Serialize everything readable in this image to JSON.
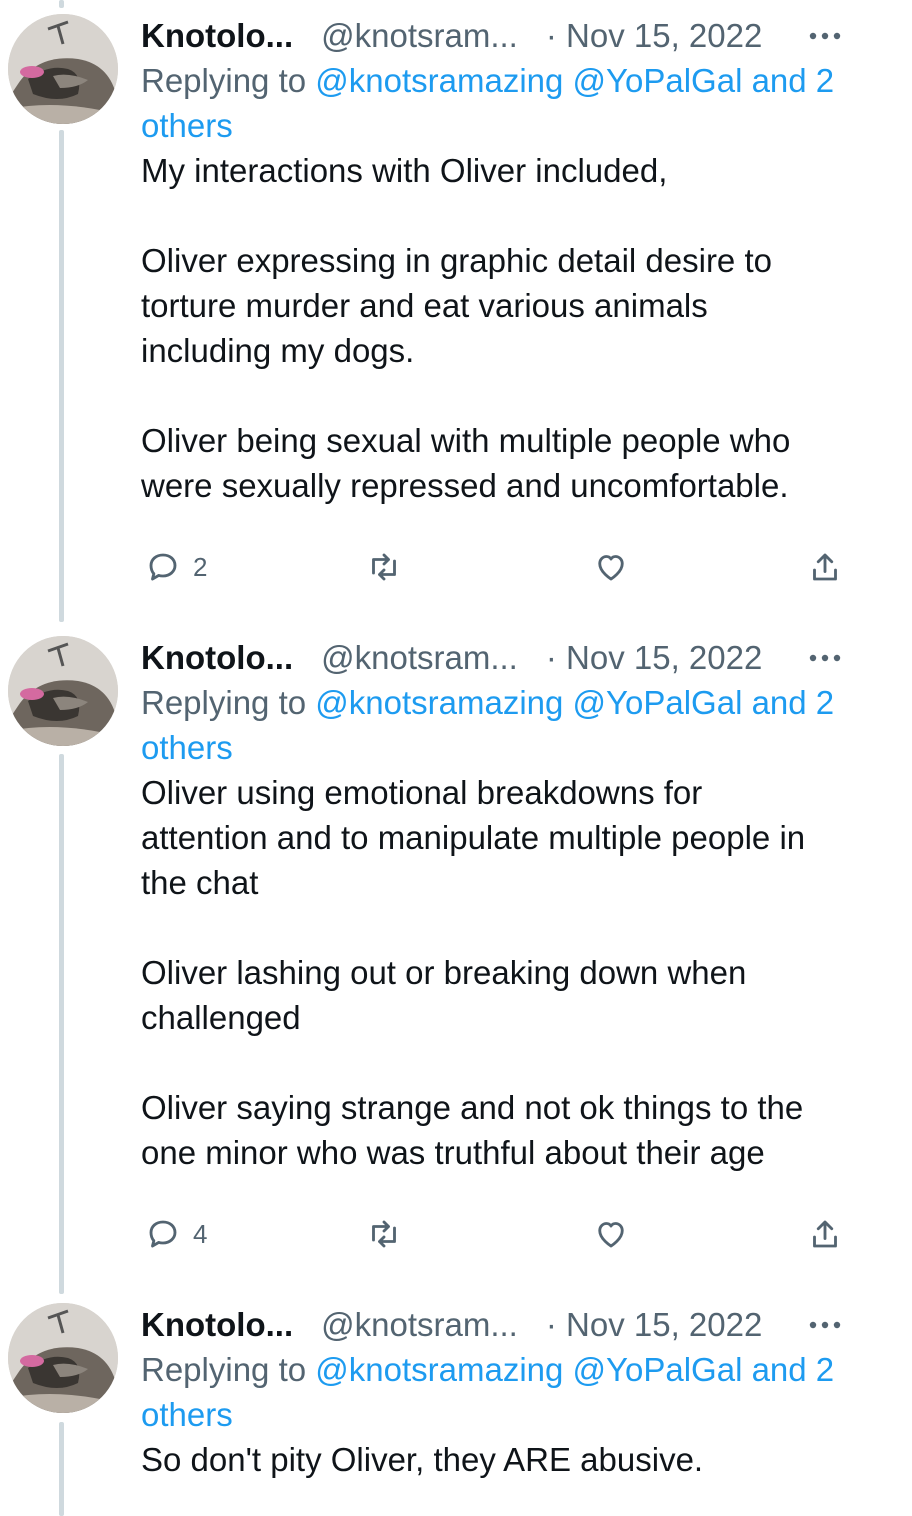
{
  "tweets": [
    {
      "display_name": "Knotolo...",
      "handle": "@knotsram...",
      "date": "· Nov 15, 2022",
      "reply_prefix": "Replying to ",
      "reply_mentions": "@knotsramazing @YoPalGal and 2",
      "reply_tail": "others",
      "lines": [
        "My interactions with Oliver included,",
        "",
        "Oliver expressing in graphic detail desire to",
        "torture murder and eat various animals",
        "including my dogs.",
        "",
        "Oliver being sexual with multiple people who",
        "were sexually repressed and uncomfortable."
      ],
      "reply_count": "2",
      "avatar_icon": "dog-photo-icon"
    },
    {
      "display_name": "Knotolo...",
      "handle": "@knotsram...",
      "date": "· Nov 15, 2022",
      "reply_prefix": "Replying to ",
      "reply_mentions": "@knotsramazing @YoPalGal and 2",
      "reply_tail": "others",
      "lines": [
        "Oliver using emotional breakdowns for",
        "attention and to manipulate multiple people in",
        "the chat",
        "",
        "Oliver lashing out or breaking down when",
        "challenged",
        "",
        "Oliver saying strange and not ok things to the",
        "one minor who was truthful about their age"
      ],
      "reply_count": "4",
      "avatar_icon": "dog-photo-icon"
    },
    {
      "display_name": "Knotolo...",
      "handle": "@knotsram...",
      "date": "· Nov 15, 2022",
      "reply_prefix": "Replying to ",
      "reply_mentions": "@knotsramazing @YoPalGal and 2",
      "reply_tail": "others",
      "lines": [
        "So don't pity Oliver, they ARE abusive."
      ],
      "reply_count": "",
      "avatar_icon": "dog-photo-icon"
    }
  ],
  "icons": {
    "reply": "reply-icon",
    "retweet": "retweet-icon",
    "like": "heart-icon",
    "share": "share-icon",
    "more": "more-icon"
  },
  "colors": {
    "text": "#0f1419",
    "secondary": "#536471",
    "link": "#1d9bf0",
    "thread_line": "#cfd9de"
  }
}
